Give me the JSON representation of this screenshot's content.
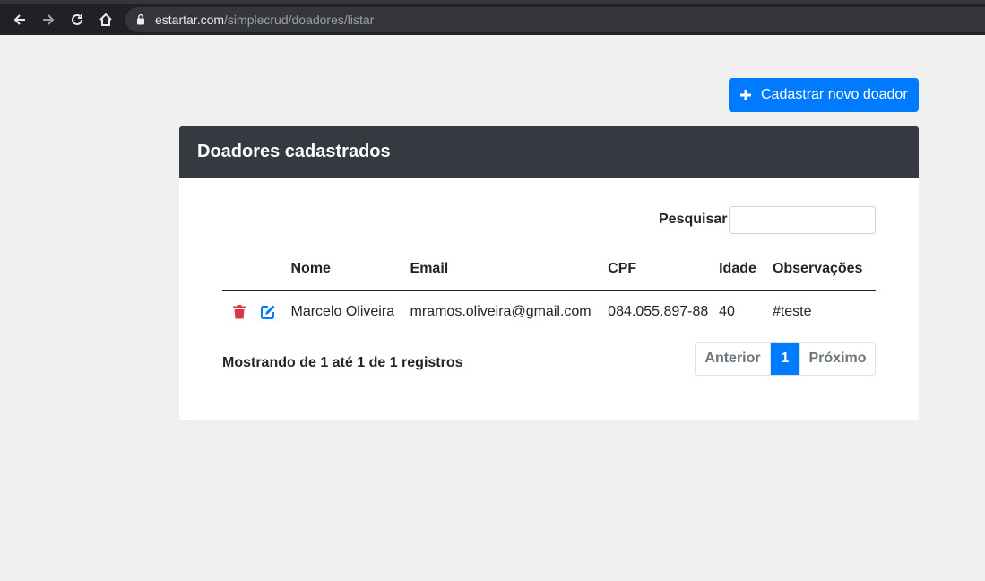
{
  "browser": {
    "url_host": "estartar.com",
    "url_path": "/simplecrud/doadores/listar"
  },
  "actions": {
    "add_label": "Cadastrar novo doador"
  },
  "card": {
    "title": "Doadores cadastrados",
    "search_label": "Pesquisar",
    "search_value": ""
  },
  "table": {
    "columns": [
      "",
      "Nome",
      "Email",
      "CPF",
      "Idade",
      "Observações"
    ],
    "rows": [
      {
        "nome": "Marcelo Oliveira",
        "email": "mramos.oliveira@gmail.com",
        "cpf": "084.055.897-88",
        "idade": "40",
        "observacoes": "#teste"
      }
    ]
  },
  "footer": {
    "info": "Mostrando de 1 até 1 de 1 registros",
    "prev_label": "Anterior",
    "current_page": "1",
    "next_label": "Próximo"
  },
  "colors": {
    "primary": "#007bff",
    "header_bg": "#343a40",
    "delete": "#dc3545",
    "page_bg": "#f0f0f0"
  },
  "icons": [
    "back-icon",
    "forward-icon",
    "reload-icon",
    "home-icon",
    "lock-icon",
    "plus-icon",
    "trash-icon",
    "edit-icon"
  ]
}
